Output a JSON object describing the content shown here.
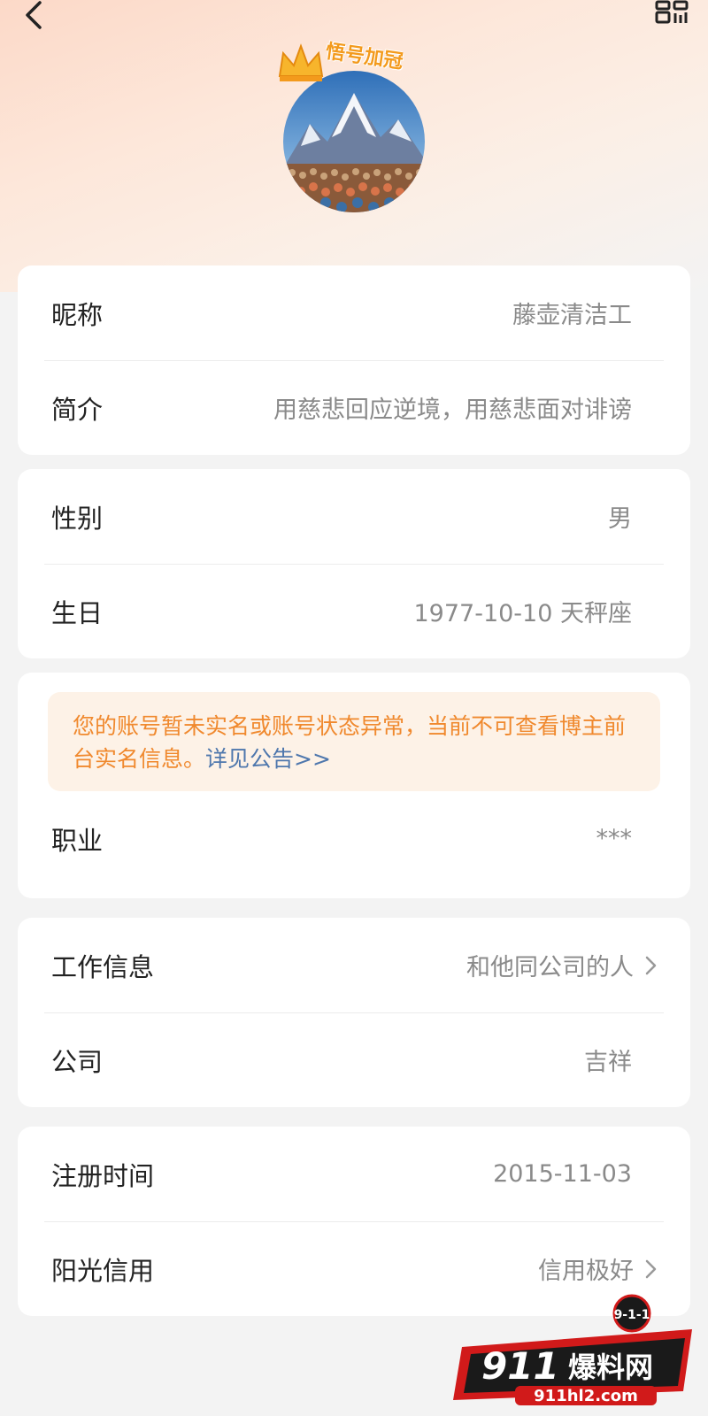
{
  "header": {
    "back_icon": "chevron-left-icon",
    "qr_icon": "qr-code-icon",
    "avatar_badge_text": "悟号加冠"
  },
  "profile_basic": {
    "nickname_label": "昵称",
    "nickname_value": "藤壶清洁工",
    "bio_label": "简介",
    "bio_value": "用慈悲回应逆境，用慈悲面对诽谤"
  },
  "profile_personal": {
    "gender_label": "性别",
    "gender_value": "男",
    "birthday_label": "生日",
    "birthday_value": "1977-10-10 天秤座"
  },
  "profile_verify": {
    "notice_text": "您的账号暂未实名或账号状态异常，当前不可查看博主前台实名信息。",
    "notice_link": "详见公告>>",
    "job_label": "职业",
    "job_value": "***"
  },
  "profile_work": {
    "workinfo_label": "工作信息",
    "workinfo_value": "和他同公司的人",
    "company_label": "公司",
    "company_value": "吉祥"
  },
  "profile_account": {
    "register_label": "注册时间",
    "register_value": "2015-11-03",
    "credit_label": "阳光信用",
    "credit_value": "信用极好"
  },
  "watermark": {
    "badge": "9-1-1",
    "title_num": "911",
    "title_cn": "爆料网",
    "url": "911hl2.com"
  },
  "colors": {
    "notice_text": "#f0892e",
    "notice_link": "#4e77ad",
    "notice_bg": "#fdf2e7",
    "value_gray": "#8a8a8a"
  }
}
